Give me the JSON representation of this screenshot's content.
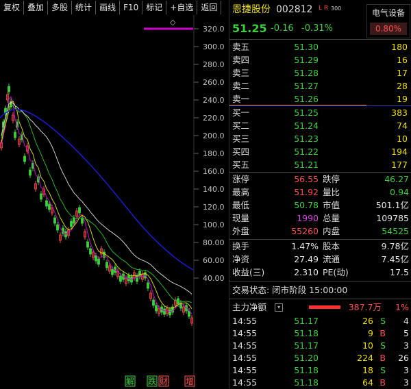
{
  "toolbar": {
    "items": [
      "复权",
      "叠加",
      "多股",
      "统计",
      "画线",
      "F10",
      "标记",
      "+自选",
      "返回"
    ]
  },
  "header": {
    "name": "恩捷股份",
    "code": "002812",
    "tags": "L R",
    "tag_num": "300",
    "price": "51.25",
    "change": "-0.16",
    "change_pct": "-0.31%",
    "sector": "电气设备",
    "sector_pct": "0.80%"
  },
  "chart": {
    "y_ticks": [
      "320.0",
      "300.0",
      "280.0",
      "260.0",
      "240.0",
      "220.0",
      "200.0",
      "180.0",
      "160.0",
      "140.0",
      "120.0",
      "100.0",
      "80.00",
      "60.00",
      "40.00"
    ],
    "bottom_tags": [
      "解",
      "跌",
      "财",
      "增"
    ],
    "top_marker": "◇"
  },
  "sells": [
    {
      "label": "卖五",
      "price": "51.30",
      "vol": "180"
    },
    {
      "label": "卖四",
      "price": "51.29",
      "vol": "16"
    },
    {
      "label": "卖三",
      "price": "51.28",
      "vol": "17"
    },
    {
      "label": "卖二",
      "price": "51.27",
      "vol": "28"
    },
    {
      "label": "卖一",
      "price": "51.26",
      "vol": "19"
    }
  ],
  "buys": [
    {
      "label": "买一",
      "price": "51.25",
      "vol": "383"
    },
    {
      "label": "买二",
      "price": "51.24",
      "vol": "74"
    },
    {
      "label": "买三",
      "price": "51.23",
      "vol": "10"
    },
    {
      "label": "买四",
      "price": "51.22",
      "vol": "194"
    },
    {
      "label": "买五",
      "price": "51.21",
      "vol": "177"
    }
  ],
  "stats1": [
    {
      "l1": "涨停",
      "v1": "56.55",
      "c1": "red",
      "l2": "跌停",
      "v2": "46.27",
      "c2": "green"
    },
    {
      "l1": "最高",
      "v1": "51.92",
      "c1": "red",
      "l2": "量比",
      "v2": "0.94",
      "c2": "green"
    },
    {
      "l1": "最低",
      "v1": "50.78",
      "c1": "green",
      "l2": "市值",
      "v2": "501.1亿",
      "c2": "white"
    },
    {
      "l1": "现量",
      "v1": "1990",
      "c1": "magenta",
      "l2": "总量",
      "v2": "109785",
      "c2": "white"
    },
    {
      "l1": "外盘",
      "v1": "55260",
      "c1": "red",
      "l2": "内盘",
      "v2": "54525",
      "c2": "green"
    }
  ],
  "stats2": [
    {
      "l1": "换手",
      "v1": "1.47%",
      "l2": "股本",
      "v2": "9.78亿"
    },
    {
      "l1": "净资",
      "v1": "27.49",
      "l2": "流通",
      "v2": "7.45亿"
    },
    {
      "l1": "收益(三)",
      "v1": "2.310",
      "l2": "PE(动)",
      "v2": "17.5"
    }
  ],
  "trade_status": "交易状态: 闭市阶段 15:00:00",
  "net_flow": {
    "label": "主力净额",
    "value": "387.7万",
    "pct": "1%"
  },
  "ticks": [
    {
      "time": "14:55",
      "price": "51.17",
      "vol": "26",
      "side": "S",
      "flag": "4"
    },
    {
      "time": "14:55",
      "price": "51.18",
      "vol": "9",
      "side": "B",
      "flag": "5"
    },
    {
      "time": "14:55",
      "price": "51.17",
      "vol": "10",
      "side": "S",
      "flag": "3"
    },
    {
      "time": "14:55",
      "price": "51.20",
      "vol": "224",
      "side": "B",
      "flag": "26"
    },
    {
      "time": "14:55",
      "price": "51.18",
      "vol": "18",
      "side": "S",
      "flag": "3"
    },
    {
      "time": "14:55",
      "price": "51.18",
      "vol": "64",
      "side": "B",
      "flag": "3"
    }
  ],
  "colors": {
    "up": "#ff4d4d",
    "down": "#3ad13a",
    "ma_blue": "#1a1ad8",
    "ma_white": "#cfcfcf",
    "ma_green": "#22b822",
    "ma_yellow": "#d8d800",
    "ma_magenta": "#d000d0"
  }
}
